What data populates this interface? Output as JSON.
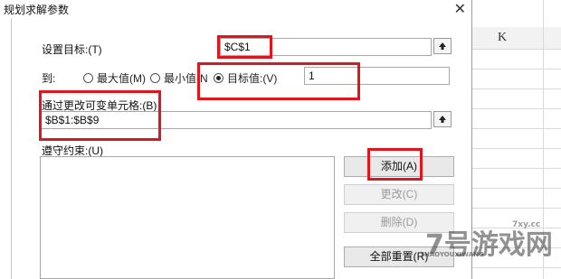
{
  "dialog": {
    "title": "规划求解参数",
    "close_glyph": "✕"
  },
  "objective": {
    "label": "设置目标:(T)",
    "value": "$C$1"
  },
  "to": {
    "label": "到:",
    "options": [
      {
        "label": "最大值(M)",
        "selected": false
      },
      {
        "label": "最小值(N",
        "selected": false
      },
      {
        "label": "目标值:(V)",
        "selected": true
      }
    ],
    "target_value": "1"
  },
  "variables": {
    "label": "通过更改可变单元格:(B)",
    "value": "$B$1:$B$9"
  },
  "constraints": {
    "label": "遵守约束:(U)",
    "items": []
  },
  "buttons": {
    "add": "添加(A)",
    "change": "更改(C)",
    "delete": "删除(D)",
    "reset_all": "全部重置(R)"
  },
  "spreadsheet": {
    "column_header": "K"
  },
  "watermark": {
    "text": "7号游戏网",
    "pinyin": "7HAOYOUXIWANG",
    "url": "7xy.cc"
  },
  "colors": {
    "highlight": "#e0161f"
  }
}
